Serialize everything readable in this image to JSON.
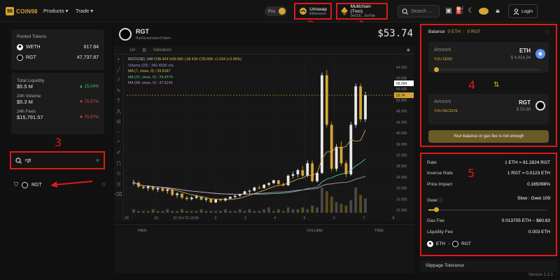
{
  "brand": "COIN98",
  "nav": {
    "products": "Products ▾",
    "trade": "Trade ▾"
  },
  "pro_label": "Pro",
  "dex": {
    "name": "Uniswap",
    "chain": "Ethereum"
  },
  "wallet": {
    "name": "Multichain (Tron)",
    "address": "0x02E...6cF9e"
  },
  "search_placeholder": "Search ...",
  "login_label": "Login",
  "annotations": [
    "1",
    "2",
    "3",
    "4",
    "5"
  ],
  "pooled": {
    "title": "Pooled Tokens",
    "tokens": [
      {
        "symbol": "WETH",
        "amount": "617.84"
      },
      {
        "symbol": "RGT",
        "amount": "47,737.87"
      }
    ]
  },
  "stats": [
    {
      "label": "Total Liquidity",
      "value": "$5.5 M",
      "change": "▲ 15.04%",
      "color": "#3fbf6b"
    },
    {
      "label": "24h Volume",
      "value": "$5.3 M",
      "change": "▼ 70.57%",
      "color": "#e04a4a"
    },
    {
      "label": "24h Fees",
      "value": "$15,791.57",
      "change": "▼ 70.57%",
      "color": "#e04a4a"
    }
  ],
  "token_search": {
    "value": "rgt",
    "clear": "×"
  },
  "result": {
    "symbol": "RGT",
    "count": "0"
  },
  "pair": {
    "symbol": "RGT",
    "name": "RariGovernanceToken",
    "price": "$53.74"
  },
  "chart_toolbar": {
    "interval": "1m",
    "indicators": "Indicators"
  },
  "ohlc": {
    "pair": "RGT/USD, 240",
    "o": "O38.434",
    "h": "H39.995",
    "l": "L38.434",
    "c": "C39.968",
    "chg": "+1.534 (+3.99%)",
    "vol": "Volume (20) ⁝ 366.453K n/a",
    "ma7": "MA (7, close, 0) ⁝ 39.8187",
    "ma25": "MA (25, close, 0) ⁝ 29.4279",
    "ma99": "MA (99, close, 0) ⁝ 37.6145"
  },
  "chart_data": {
    "type": "candlestick",
    "y_ticks": [
      "64.000",
      "60.000",
      "58.094",
      "56.000",
      "53.74",
      "52.000",
      "48.000",
      "44.000",
      "40.000",
      "36.000",
      "32.000",
      "28.000",
      "24.000",
      "20.000",
      "16.000",
      "12.000"
    ],
    "x_ticks": [
      "30",
      "31",
      "31 Oct '21  16:00",
      "2",
      "3",
      "4",
      "5",
      "6",
      "7",
      "8"
    ],
    "ylim": [
      11,
      67
    ],
    "current_price": 53.74,
    "candles": [
      [
        22,
        23,
        21,
        22
      ],
      [
        22,
        22.5,
        20,
        20.5
      ],
      [
        20.5,
        21,
        19.5,
        20
      ],
      [
        20,
        21,
        19,
        20.5
      ],
      [
        20.5,
        21,
        19,
        19.5
      ],
      [
        19.5,
        20.5,
        18.5,
        20
      ],
      [
        20,
        20.5,
        18.5,
        19
      ],
      [
        19,
        20,
        18,
        19.5
      ],
      [
        19.5,
        19.5,
        17,
        17.5
      ],
      [
        17.5,
        18.5,
        16.5,
        18
      ],
      [
        18,
        18,
        16,
        16.5
      ],
      [
        16.5,
        17,
        15.5,
        16
      ],
      [
        16,
        17,
        15.5,
        16.5
      ],
      [
        16.5,
        17.5,
        16,
        17
      ],
      [
        17,
        17,
        15.5,
        15.8
      ],
      [
        15.8,
        16.5,
        15,
        16.2
      ],
      [
        16.2,
        16.2,
        14.5,
        14.8
      ],
      [
        14.8,
        16,
        14.5,
        15.8
      ],
      [
        15.8,
        16.2,
        15,
        15.5
      ],
      [
        15.5,
        16.5,
        15,
        16.2
      ],
      [
        16.2,
        17,
        15.8,
        16.8
      ],
      [
        16.8,
        17.5,
        16,
        17.2
      ],
      [
        17.2,
        18,
        16.8,
        17.8
      ],
      [
        17.8,
        19,
        17.5,
        18.8
      ],
      [
        18.8,
        19.5,
        18,
        19
      ],
      [
        19,
        20.5,
        18.8,
        20.2
      ],
      [
        20.2,
        21,
        19.5,
        20
      ],
      [
        20,
        21.5,
        19.8,
        21.2
      ],
      [
        21.2,
        22,
        20.5,
        21.8
      ],
      [
        21.8,
        23,
        21.5,
        22.8
      ],
      [
        22.8,
        23,
        21,
        21.5
      ],
      [
        21.5,
        22,
        20.5,
        21
      ],
      [
        21,
        25,
        20.8,
        24.5
      ],
      [
        24.5,
        26,
        23.5,
        25
      ],
      [
        25,
        27,
        24,
        26.5
      ],
      [
        26.5,
        28,
        24,
        24.5
      ],
      [
        24.5,
        30,
        24,
        29
      ],
      [
        29,
        30,
        22,
        22.5
      ],
      [
        22.5,
        26,
        22,
        25.5
      ],
      [
        25.5,
        62,
        25,
        61
      ],
      [
        61,
        63,
        42,
        43
      ],
      [
        43,
        44,
        26,
        27
      ],
      [
        27,
        36,
        26,
        35
      ],
      [
        35,
        37,
        28,
        29
      ],
      [
        29,
        30,
        24,
        25
      ],
      [
        25,
        44,
        24.5,
        43
      ],
      [
        43,
        58,
        42,
        57
      ],
      [
        57,
        58,
        44,
        45
      ],
      [
        45,
        55,
        44,
        53.74
      ]
    ],
    "volumes": [
      2,
      1,
      1,
      1,
      2,
      1,
      1,
      2,
      1,
      1,
      2,
      1,
      1,
      1,
      2,
      1,
      1,
      1,
      1,
      2,
      1,
      1,
      2,
      1,
      2,
      1,
      1,
      2,
      3,
      1,
      2,
      1,
      3,
      2,
      2,
      3,
      2,
      4,
      3,
      14,
      12,
      9,
      6,
      5,
      4,
      7,
      14,
      10,
      8
    ]
  },
  "trade_headers": {
    "pair": "PAIR",
    "volume": "VOLUME",
    "time": "TIME"
  },
  "swap": {
    "balance_label": "Balance",
    "balance_eth": "0 ETH",
    "balance_rgt": "0 RGT",
    "from_label": "Amount",
    "from_token": "ETH",
    "from_usd": "$ 4,414.24",
    "you_send": "YOU SEND",
    "to_label": "Amount",
    "to_token": "RGT",
    "to_usd": "$ 53.89",
    "you_receive": "YOU RECEIVE",
    "error": "Your balance or gas fee is not enough"
  },
  "info": {
    "rate_label": "Rate",
    "rate": "1 ETH = 81.2824 RGT",
    "inverse_label": "Inverse Rate",
    "inverse": "1 RGT = 0.0123 ETH",
    "impact_label": "Price Impact",
    "impact": "0.165098%",
    "gwei_label": "Gwei",
    "gwei": "Slow : Gwei 109",
    "gasfee_label": "Gas Fee",
    "gasfee": "0.013705 ETH ~ $60.83",
    "liqfee_label": "Liquidity Fee",
    "liqfee": "0.003 ETH",
    "route_from": "ETH",
    "route_to": "RGT"
  },
  "slippage_label": "Slippage Tolerance",
  "version": "Version 1.2.1"
}
